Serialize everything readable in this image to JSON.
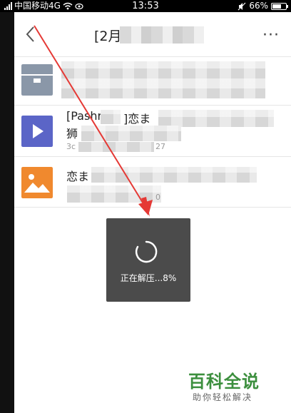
{
  "status_bar": {
    "carrier": "中国移动4G",
    "time": "13:53",
    "battery": "66%",
    "battery_level": 0.66
  },
  "header": {
    "title": "[2月"
  },
  "files": [
    {
      "name": "",
      "meta": "",
      "icon": "archive-icon",
      "color": "#8a97a8"
    },
    {
      "name": "[Pashr",
      "name_suffix": "]恋ま",
      "name_line2": "狮",
      "meta": "3c",
      "meta_suffix": "27",
      "icon": "video-icon",
      "color": "#5b65c7"
    },
    {
      "name": "恋ま",
      "meta": "",
      "meta_suffix": "0",
      "icon": "image-icon",
      "color": "#f0892e"
    }
  ],
  "toast": {
    "message": "正在解压...8%",
    "progress": 0.08
  },
  "watermark": {
    "title": "百科全说",
    "subtitle": "助你轻松解决"
  },
  "colors": {
    "arrow": "#e53935",
    "watermark": "#3c8f3e"
  }
}
